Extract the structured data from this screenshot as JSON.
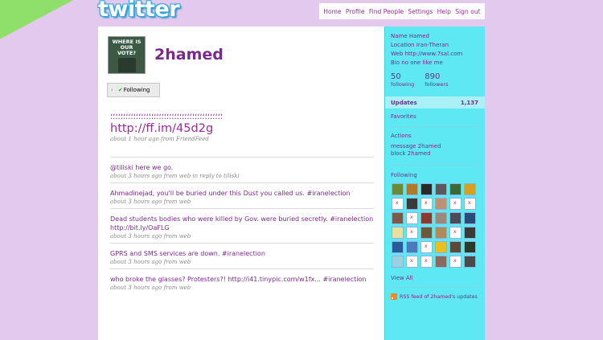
{
  "logo": "twitter",
  "nav": [
    "Home",
    "Profile",
    "Find People",
    "Settings",
    "Help",
    "Sign out"
  ],
  "profile": {
    "username": "2hamed",
    "avatar_text": "WHERE IS OUR VOTE?",
    "follow_label": "Following"
  },
  "first_tweet": {
    "text": "؛؛؛؛؛؛؛؛؛؛؛؛؛؛؛؛؛؛؛؛؛؛؛؛؛؛؛؛؛؛؛؛؛؛؛؛؛؛؛؛؛؛؛؛",
    "link": "http://ff.im/45d2g",
    "meta": "about 1 hour ago from FriendFeed"
  },
  "tweets": [
    {
      "text": "@tiliski here we go.",
      "meta": "about 3 hours ago from web in reply to tiliski"
    },
    {
      "text": "Ahmadinejad, you'll be buried under this Dust you called us. #iranelection",
      "meta": "about 3 hours ago from web"
    },
    {
      "text": "Dead students bodies who were killed by Gov. were buried secretly. #iranelection http://bit.ly/OaFLG",
      "meta": "about 3 hours ago from web"
    },
    {
      "text": "GPRS and SMS services are down. #iranelection",
      "meta": "about 3 hours ago from web"
    },
    {
      "text": "who broke the glasses? Protesters?! http://i41.tinypic.com/w1fx... #iranelection",
      "meta": "about 3 hours ago from web"
    }
  ],
  "sidebar": {
    "name": "Name Hamed",
    "location": "Location Iran-Theran",
    "web": "Web http://www.7sal.com",
    "bio": "Bio no one like me",
    "following_count": "50",
    "following_label": "following",
    "followers_count": "890",
    "followers_label": "followers",
    "updates_label": "Updates",
    "updates_count": "1,137",
    "favorites": "Favorites",
    "actions_title": "Actions",
    "action_message": "message 2hamed",
    "action_block": "block 2hamed",
    "following_title": "Following",
    "view_all": "View All",
    "rss": "RSS feed of 2hamed's updates"
  },
  "colors": {
    "background": "#e3c9ee",
    "sidebar": "#5de8f4",
    "link": "#9b2a9b",
    "ribbon": "#8fe06a"
  }
}
